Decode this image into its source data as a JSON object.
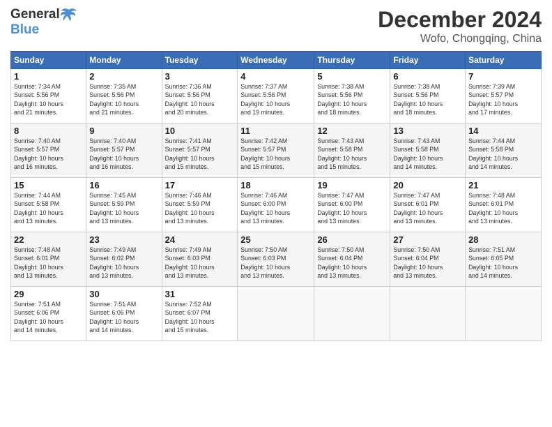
{
  "header": {
    "logo_general": "General",
    "logo_blue": "Blue",
    "title": "December 2024",
    "subtitle": "Wofo, Chongqing, China"
  },
  "calendar": {
    "headers": [
      "Sunday",
      "Monday",
      "Tuesday",
      "Wednesday",
      "Thursday",
      "Friday",
      "Saturday"
    ],
    "weeks": [
      [
        null,
        null,
        null,
        null,
        null,
        null,
        null
      ]
    ]
  },
  "days": {
    "1": {
      "num": "1",
      "sunrise": "Sunrise: 7:34 AM",
      "sunset": "Sunset: 5:56 PM",
      "daylight": "Daylight: 10 hours and 21 minutes."
    },
    "2": {
      "num": "2",
      "sunrise": "Sunrise: 7:35 AM",
      "sunset": "Sunset: 5:56 PM",
      "daylight": "Daylight: 10 hours and 21 minutes."
    },
    "3": {
      "num": "3",
      "sunrise": "Sunrise: 7:36 AM",
      "sunset": "Sunset: 5:56 PM",
      "daylight": "Daylight: 10 hours and 20 minutes."
    },
    "4": {
      "num": "4",
      "sunrise": "Sunrise: 7:37 AM",
      "sunset": "Sunset: 5:56 PM",
      "daylight": "Daylight: 10 hours and 19 minutes."
    },
    "5": {
      "num": "5",
      "sunrise": "Sunrise: 7:38 AM",
      "sunset": "Sunset: 5:56 PM",
      "daylight": "Daylight: 10 hours and 18 minutes."
    },
    "6": {
      "num": "6",
      "sunrise": "Sunrise: 7:38 AM",
      "sunset": "Sunset: 5:56 PM",
      "daylight": "Daylight: 10 hours and 18 minutes."
    },
    "7": {
      "num": "7",
      "sunrise": "Sunrise: 7:39 AM",
      "sunset": "Sunset: 5:57 PM",
      "daylight": "Daylight: 10 hours and 17 minutes."
    },
    "8": {
      "num": "8",
      "sunrise": "Sunrise: 7:40 AM",
      "sunset": "Sunset: 5:57 PM",
      "daylight": "Daylight: 10 hours and 16 minutes."
    },
    "9": {
      "num": "9",
      "sunrise": "Sunrise: 7:40 AM",
      "sunset": "Sunset: 5:57 PM",
      "daylight": "Daylight: 10 hours and 16 minutes."
    },
    "10": {
      "num": "10",
      "sunrise": "Sunrise: 7:41 AM",
      "sunset": "Sunset: 5:57 PM",
      "daylight": "Daylight: 10 hours and 15 minutes."
    },
    "11": {
      "num": "11",
      "sunrise": "Sunrise: 7:42 AM",
      "sunset": "Sunset: 5:57 PM",
      "daylight": "Daylight: 10 hours and 15 minutes."
    },
    "12": {
      "num": "12",
      "sunrise": "Sunrise: 7:43 AM",
      "sunset": "Sunset: 5:58 PM",
      "daylight": "Daylight: 10 hours and 15 minutes."
    },
    "13": {
      "num": "13",
      "sunrise": "Sunrise: 7:43 AM",
      "sunset": "Sunset: 5:58 PM",
      "daylight": "Daylight: 10 hours and 14 minutes."
    },
    "14": {
      "num": "14",
      "sunrise": "Sunrise: 7:44 AM",
      "sunset": "Sunset: 5:58 PM",
      "daylight": "Daylight: 10 hours and 14 minutes."
    },
    "15": {
      "num": "15",
      "sunrise": "Sunrise: 7:44 AM",
      "sunset": "Sunset: 5:58 PM",
      "daylight": "Daylight: 10 hours and 13 minutes."
    },
    "16": {
      "num": "16",
      "sunrise": "Sunrise: 7:45 AM",
      "sunset": "Sunset: 5:59 PM",
      "daylight": "Daylight: 10 hours and 13 minutes."
    },
    "17": {
      "num": "17",
      "sunrise": "Sunrise: 7:46 AM",
      "sunset": "Sunset: 5:59 PM",
      "daylight": "Daylight: 10 hours and 13 minutes."
    },
    "18": {
      "num": "18",
      "sunrise": "Sunrise: 7:46 AM",
      "sunset": "Sunset: 6:00 PM",
      "daylight": "Daylight: 10 hours and 13 minutes."
    },
    "19": {
      "num": "19",
      "sunrise": "Sunrise: 7:47 AM",
      "sunset": "Sunset: 6:00 PM",
      "daylight": "Daylight: 10 hours and 13 minutes."
    },
    "20": {
      "num": "20",
      "sunrise": "Sunrise: 7:47 AM",
      "sunset": "Sunset: 6:01 PM",
      "daylight": "Daylight: 10 hours and 13 minutes."
    },
    "21": {
      "num": "21",
      "sunrise": "Sunrise: 7:48 AM",
      "sunset": "Sunset: 6:01 PM",
      "daylight": "Daylight: 10 hours and 13 minutes."
    },
    "22": {
      "num": "22",
      "sunrise": "Sunrise: 7:48 AM",
      "sunset": "Sunset: 6:01 PM",
      "daylight": "Daylight: 10 hours and 13 minutes."
    },
    "23": {
      "num": "23",
      "sunrise": "Sunrise: 7:49 AM",
      "sunset": "Sunset: 6:02 PM",
      "daylight": "Daylight: 10 hours and 13 minutes."
    },
    "24": {
      "num": "24",
      "sunrise": "Sunrise: 7:49 AM",
      "sunset": "Sunset: 6:03 PM",
      "daylight": "Daylight: 10 hours and 13 minutes."
    },
    "25": {
      "num": "25",
      "sunrise": "Sunrise: 7:50 AM",
      "sunset": "Sunset: 6:03 PM",
      "daylight": "Daylight: 10 hours and 13 minutes."
    },
    "26": {
      "num": "26",
      "sunrise": "Sunrise: 7:50 AM",
      "sunset": "Sunset: 6:04 PM",
      "daylight": "Daylight: 10 hours and 13 minutes."
    },
    "27": {
      "num": "27",
      "sunrise": "Sunrise: 7:50 AM",
      "sunset": "Sunset: 6:04 PM",
      "daylight": "Daylight: 10 hours and 13 minutes."
    },
    "28": {
      "num": "28",
      "sunrise": "Sunrise: 7:51 AM",
      "sunset": "Sunset: 6:05 PM",
      "daylight": "Daylight: 10 hours and 14 minutes."
    },
    "29": {
      "num": "29",
      "sunrise": "Sunrise: 7:51 AM",
      "sunset": "Sunset: 6:06 PM",
      "daylight": "Daylight: 10 hours and 14 minutes."
    },
    "30": {
      "num": "30",
      "sunrise": "Sunrise: 7:51 AM",
      "sunset": "Sunset: 6:06 PM",
      "daylight": "Daylight: 10 hours and 14 minutes."
    },
    "31": {
      "num": "31",
      "sunrise": "Sunrise: 7:52 AM",
      "sunset": "Sunset: 6:07 PM",
      "daylight": "Daylight: 10 hours and 15 minutes."
    }
  }
}
